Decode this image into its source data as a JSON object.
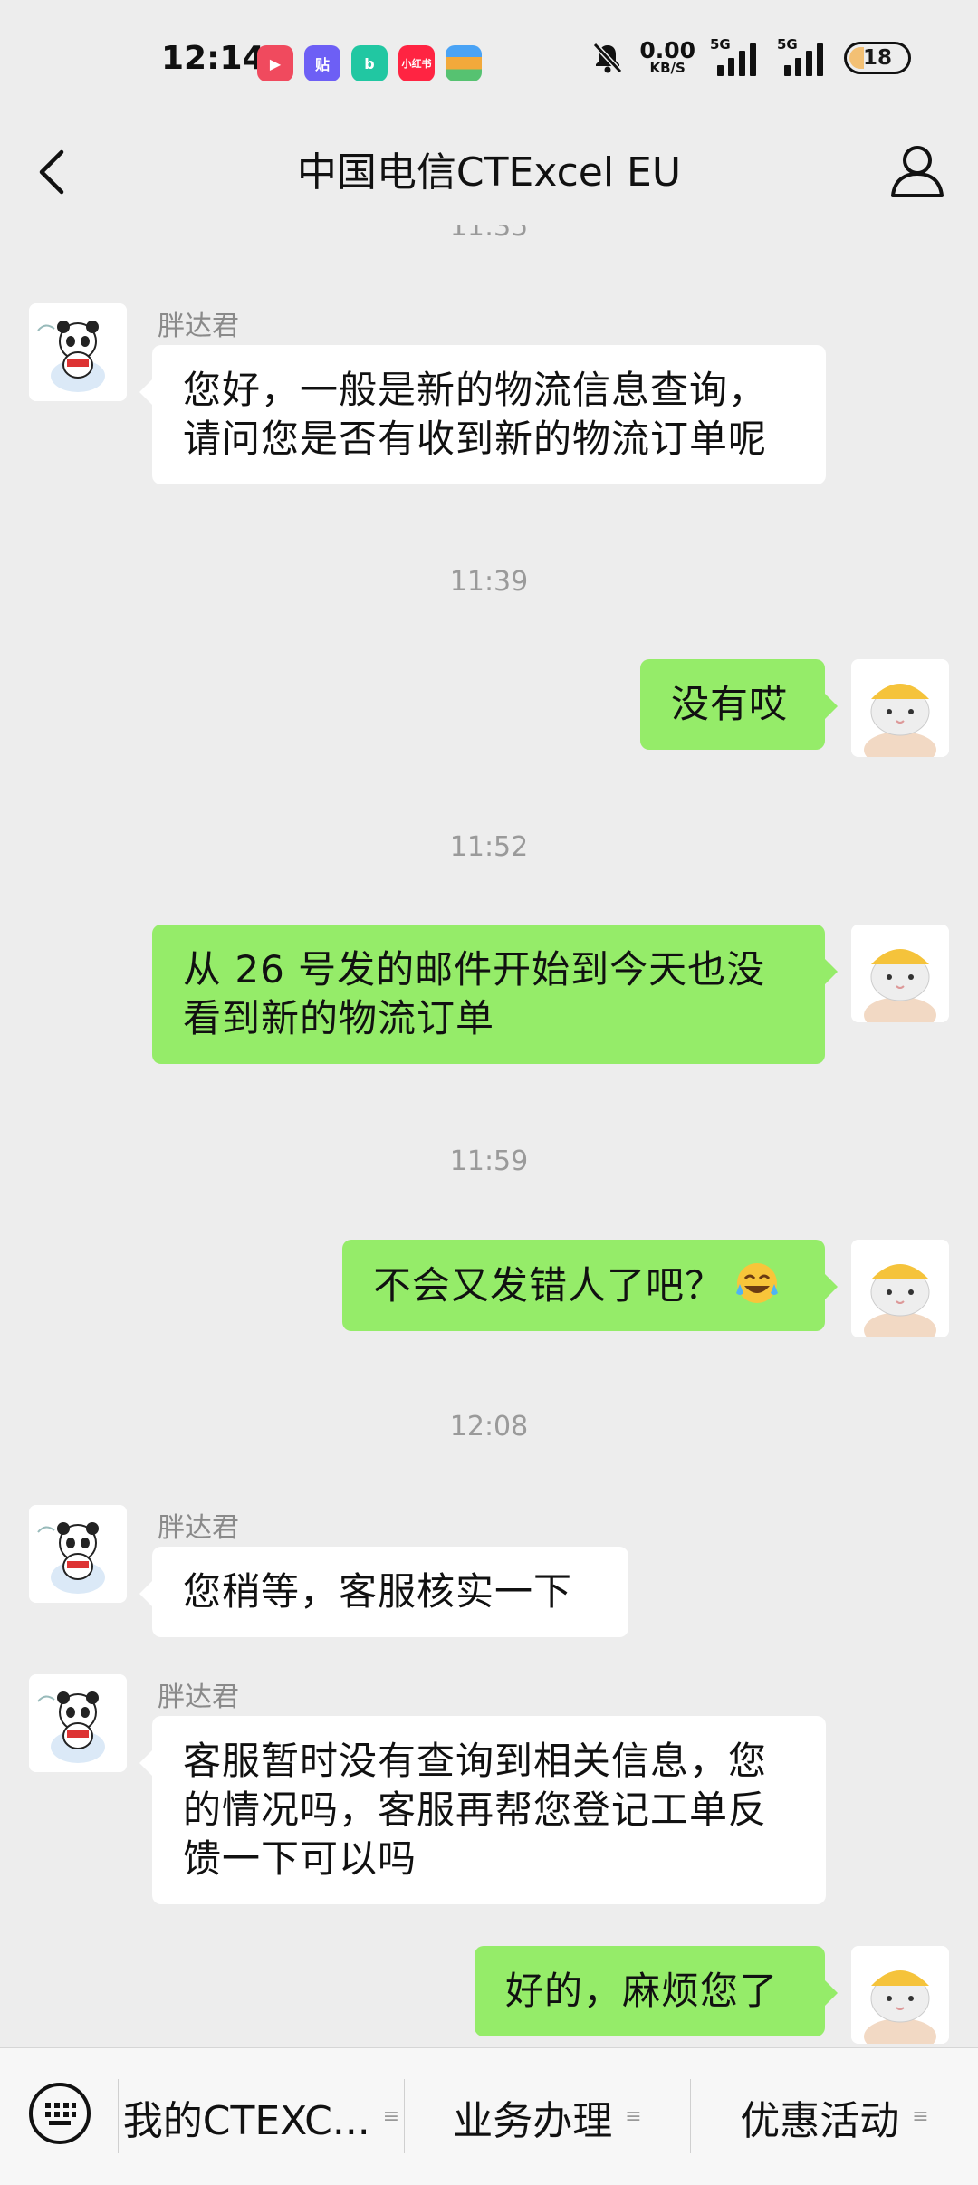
{
  "status_bar": {
    "time": "12:14",
    "apps": [
      {
        "icon": "video-app-icon",
        "label": "▶",
        "color": "#f04a5e"
      },
      {
        "icon": "tieba-app-icon",
        "label": "贴",
        "color": "#6d5ff5"
      },
      {
        "icon": "bilibili-app-icon",
        "label": "b",
        "color": "#21c7a2"
      },
      {
        "icon": "xiaohongshu-app-icon",
        "label": "小红书",
        "color": "#ff2442"
      },
      {
        "icon": "wallet-app-icon",
        "label": "",
        "color": "#f2a93b"
      }
    ],
    "speed_value": "0.00",
    "speed_unit": "KB/S",
    "signal_1": "5G",
    "signal_2": "5G",
    "battery": "18"
  },
  "nav": {
    "title": "中国电信CTExcel EU"
  },
  "chat": {
    "partial_time": "11:35",
    "messages": [
      {
        "side": "left",
        "sender": "胖达君",
        "lines": [
          "您好，一般是新的物流信息查询，",
          "请问您是否有收到新的物流订单呢"
        ]
      },
      {
        "time": "11:39"
      },
      {
        "side": "right",
        "lines": [
          "没有哎"
        ]
      },
      {
        "time": "11:52"
      },
      {
        "side": "right",
        "lines": [
          "从 26 号发的邮件开始到今天也没",
          "看到新的物流订单"
        ]
      },
      {
        "time": "11:59"
      },
      {
        "side": "right",
        "lines": [
          "不会又发错人了吧？"
        ],
        "emoji": "laughing-crying-emoji"
      },
      {
        "time": "12:08"
      },
      {
        "side": "left",
        "sender": "胖达君",
        "lines": [
          "您稍等，客服核实一下"
        ]
      },
      {
        "side": "left",
        "sender": "胖达君",
        "lines": [
          "客服暂时没有查询到相关信息，您",
          "的情况吗，客服再帮您登记工单反",
          "馈一下可以吗"
        ]
      },
      {
        "side": "right",
        "lines": [
          "好的，麻烦您了"
        ]
      }
    ]
  },
  "bottom_menu": {
    "items": [
      "我的CTEXC...",
      "业务办理",
      "优惠活动"
    ]
  }
}
